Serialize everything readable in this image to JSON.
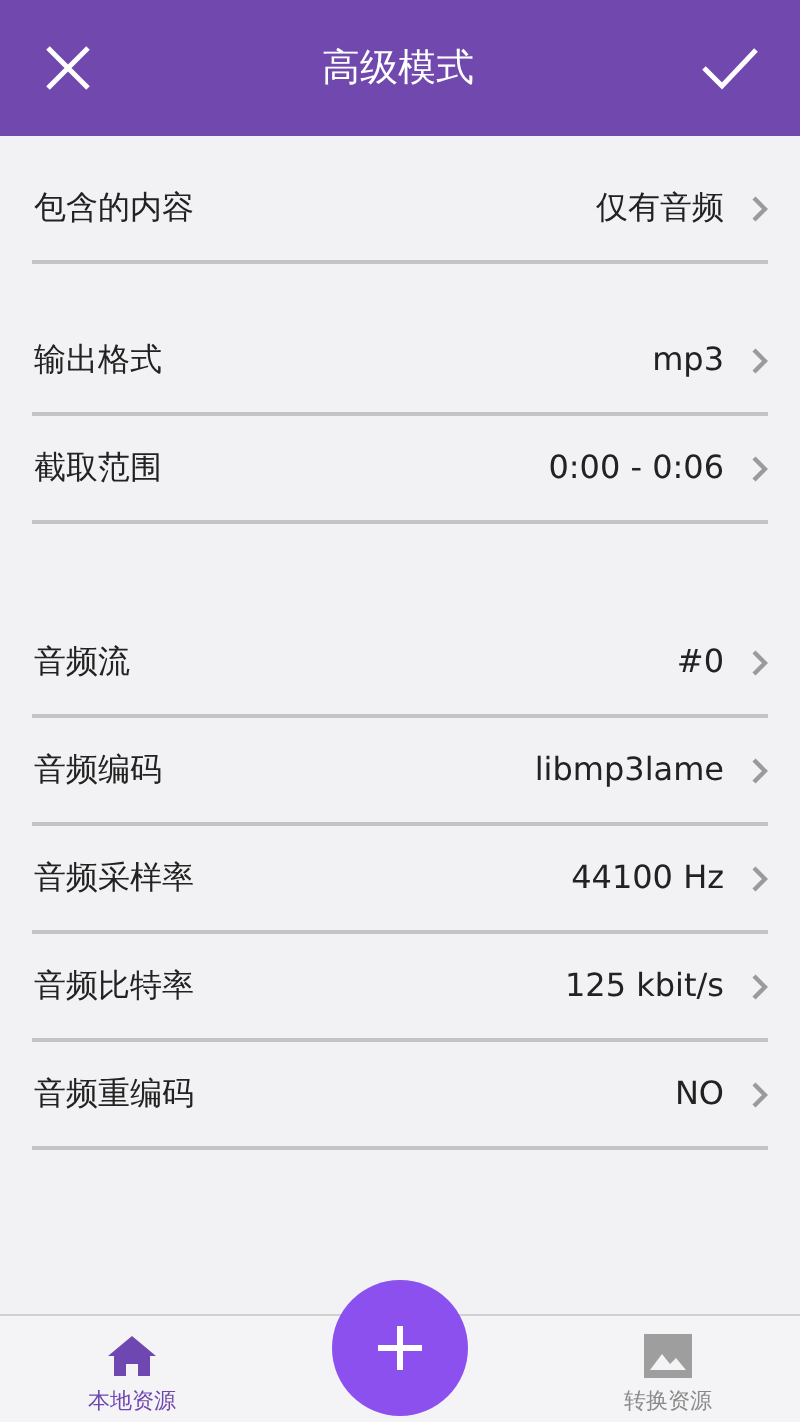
{
  "header": {
    "title": "高级模式"
  },
  "sections": [
    {
      "rows": [
        {
          "label": "包含的内容",
          "value": "仅有音频"
        }
      ]
    },
    {
      "rows": [
        {
          "label": "输出格式",
          "value": "mp3"
        },
        {
          "label": "截取范围",
          "value": "0:00 - 0:06"
        }
      ]
    },
    {
      "rows": [
        {
          "label": "音频流",
          "value": "#0"
        },
        {
          "label": "音频编码",
          "value": "libmp3lame"
        },
        {
          "label": "音频采样率",
          "value": "44100 Hz"
        },
        {
          "label": "音频比特率",
          "value": "125 kbit/s"
        },
        {
          "label": "音频重编码",
          "value": "NO"
        }
      ]
    }
  ],
  "bottom_nav": [
    {
      "label": "本地资源",
      "kind": "home",
      "selected": true
    },
    {
      "label": "转换资源",
      "kind": "image",
      "selected": false
    }
  ]
}
